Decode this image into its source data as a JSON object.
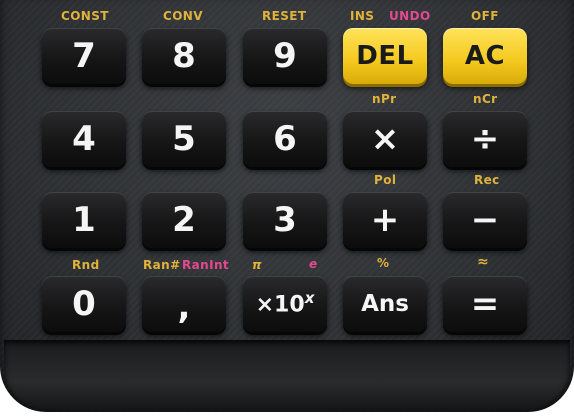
{
  "colors": {
    "body": "#2d3033",
    "key": "#161617",
    "key_text": "#f5f5f5",
    "yellow_key": "#f4c81e",
    "shift_gold": "#e0b23a",
    "alpha_pink": "#e4498f"
  },
  "rows": [
    {
      "keys": [
        {
          "label": "7",
          "shift": "CONST",
          "alpha": ""
        },
        {
          "label": "8",
          "shift": "CONV",
          "alpha": ""
        },
        {
          "label": "9",
          "shift": "RESET",
          "alpha": ""
        },
        {
          "label": "DEL",
          "shift": "INS",
          "alpha": "UNDO"
        },
        {
          "label": "AC",
          "shift": "OFF",
          "alpha": ""
        }
      ]
    },
    {
      "keys": [
        {
          "label": "4",
          "shift": "",
          "alpha": ""
        },
        {
          "label": "5",
          "shift": "",
          "alpha": ""
        },
        {
          "label": "6",
          "shift": "",
          "alpha": ""
        },
        {
          "label": "×",
          "shift": "nPr",
          "alpha": ""
        },
        {
          "label": "÷",
          "shift": "nCr",
          "alpha": ""
        }
      ]
    },
    {
      "keys": [
        {
          "label": "1",
          "shift": "",
          "alpha": ""
        },
        {
          "label": "2",
          "shift": "",
          "alpha": ""
        },
        {
          "label": "3",
          "shift": "",
          "alpha": ""
        },
        {
          "label": "+",
          "shift": "Pol",
          "alpha": ""
        },
        {
          "label": "−",
          "shift": "Rec",
          "alpha": ""
        }
      ]
    },
    {
      "keys": [
        {
          "label": "0",
          "shift": "Rnd",
          "alpha": ""
        },
        {
          "label": ",",
          "shift": "Ran#",
          "alpha": "RanInt"
        },
        {
          "label": "×10",
          "label_sup": "x",
          "shift": "π",
          "alpha": "e"
        },
        {
          "label": "Ans",
          "shift": "%",
          "alpha": ""
        },
        {
          "label": "=",
          "shift": "≈",
          "alpha": ""
        }
      ]
    }
  ]
}
